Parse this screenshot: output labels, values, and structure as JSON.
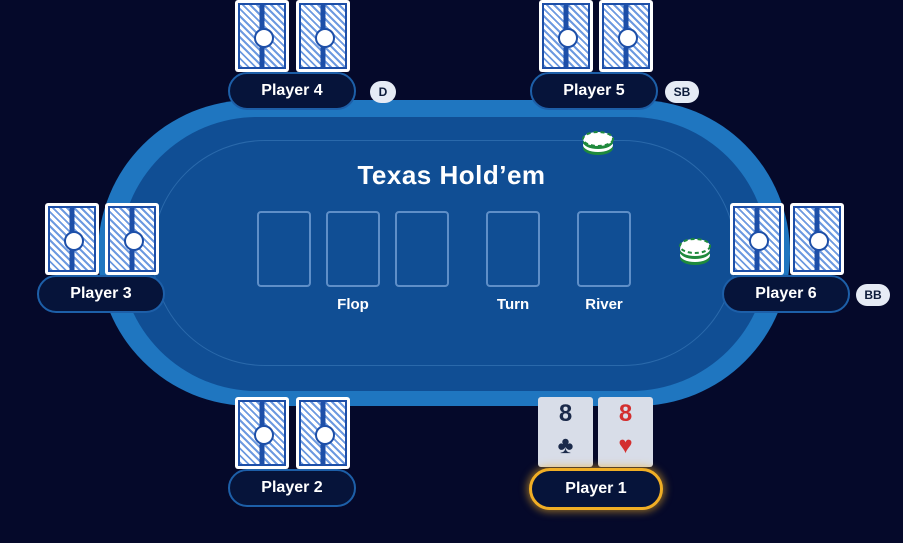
{
  "table": {
    "title": "Texas Hold’em",
    "colors": {
      "rail": "#1f76c0",
      "felt": "#104e94",
      "background": "#05092a",
      "active_ring": "#f0ae25"
    },
    "board_labels": {
      "flop": "Flop",
      "turn": "Turn",
      "river": "River"
    }
  },
  "players": {
    "p1": {
      "name": "Player 1",
      "active": true,
      "cards": [
        {
          "rank": "8",
          "suit": "♣",
          "color": "#1b2a4a"
        },
        {
          "rank": "8",
          "suit": "♥",
          "color": "#d32f2f"
        }
      ]
    },
    "p2": {
      "name": "Player 2"
    },
    "p3": {
      "name": "Player 3"
    },
    "p4": {
      "name": "Player 4",
      "badge": "D"
    },
    "p5": {
      "name": "Player 5",
      "badge": "SB"
    },
    "p6": {
      "name": "Player 6",
      "badge": "BB"
    }
  },
  "icons": {
    "chips": "chip-stack-icon",
    "cardback": "card-back-icon"
  }
}
